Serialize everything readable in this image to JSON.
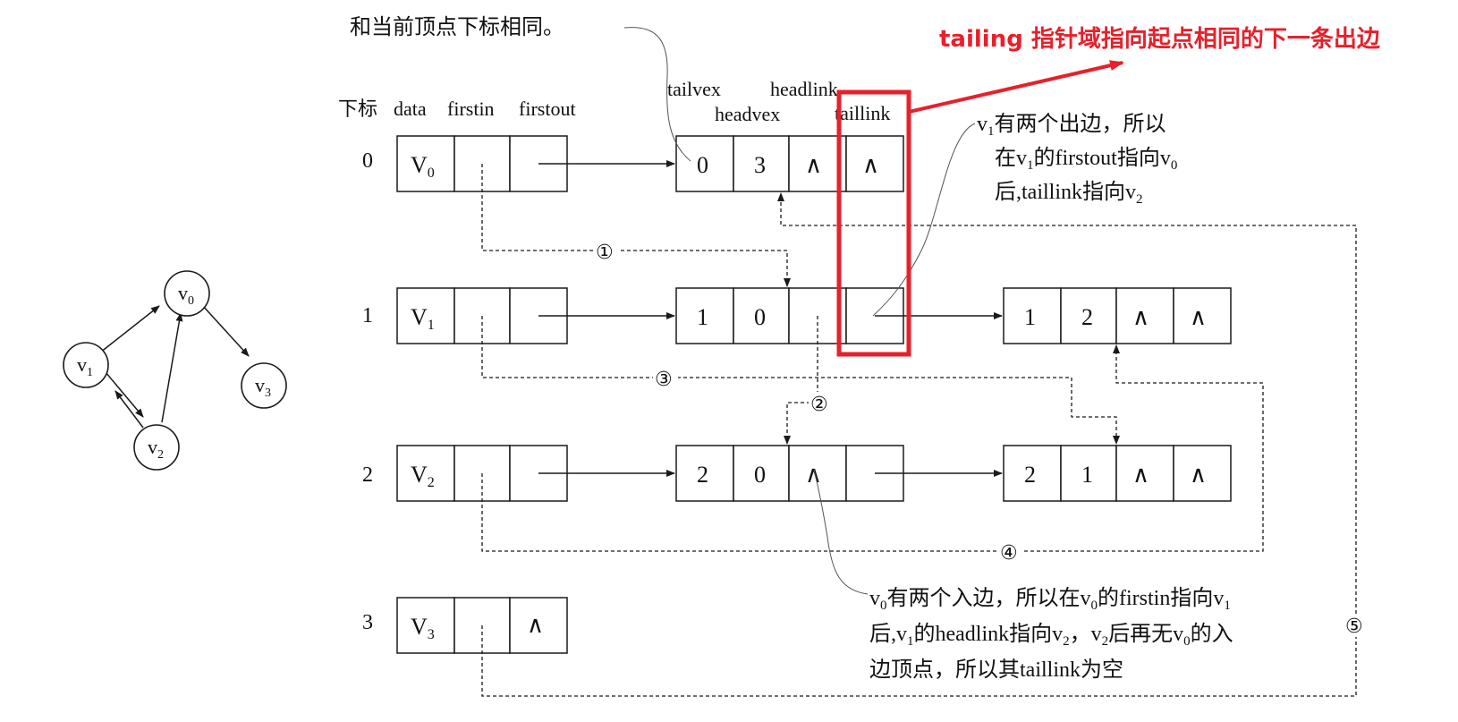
{
  "headers": {
    "index": "下标",
    "data": "data",
    "firstin": "firstin",
    "firstout": "firstout",
    "tailvex": "tailvex",
    "headvex": "headvex",
    "headlink": "headlink",
    "taillink": "taillink"
  },
  "vertex_table": [
    {
      "index": "0",
      "data": "V",
      "sub": "0",
      "firstout_null": ""
    },
    {
      "index": "1",
      "data": "V",
      "sub": "1",
      "firstout_null": ""
    },
    {
      "index": "2",
      "data": "V",
      "sub": "2",
      "firstout_null": ""
    },
    {
      "index": "3",
      "data": "V",
      "sub": "3",
      "firstout_null": "∧"
    }
  ],
  "edge_nodes": [
    {
      "tailvex": "0",
      "headvex": "3",
      "headlink": "∧",
      "taillink": "∧"
    },
    {
      "tailvex": "1",
      "headvex": "0",
      "headlink": "",
      "taillink": ""
    },
    {
      "tailvex": "1",
      "headvex": "2",
      "headlink": "∧",
      "taillink": "∧"
    },
    {
      "tailvex": "2",
      "headvex": "0",
      "headlink": "∧",
      "taillink": ""
    },
    {
      "tailvex": "2",
      "headvex": "1",
      "headlink": "∧",
      "taillink": "∧"
    }
  ],
  "graph_nodes": [
    {
      "label": "v",
      "sub": "0"
    },
    {
      "label": "v",
      "sub": "1"
    },
    {
      "label": "v",
      "sub": "2"
    },
    {
      "label": "v",
      "sub": "3"
    }
  ],
  "markers": [
    "①",
    "②",
    "③",
    "④",
    "⑤"
  ],
  "annotations": {
    "top_left": "和当前顶点下标相同。",
    "red_note": "tailing 指针域指向起点相同的下一条出边",
    "v1_note": {
      "line1_a": "v",
      "line1_sub": "1",
      "line1_b": "有两个出边，所以",
      "line2_a": "在v",
      "line2_sub": "1",
      "line2_b": "的firstout指向v",
      "line2_sub2": "0",
      "line3_a": "后,taillink指向v",
      "line3_sub": "2"
    },
    "v0_note": {
      "line1_a": "v",
      "line1_s1": "0",
      "line1_b": "有两个入边，所以在v",
      "line1_s2": "0",
      "line1_c": "的firstin指向v",
      "line1_s3": "1",
      "line2_a": "后,v",
      "line2_s1": "1",
      "line2_b": "的headlink指向v",
      "line2_s2": "2",
      "line2_c": "，v",
      "line2_s3": "2",
      "line2_d": "后再无v",
      "line2_s4": "0",
      "line2_e": "的入",
      "line3": "边顶点，所以其taillink为空"
    }
  },
  "colors": {
    "highlight": "#e8202b",
    "ink": "#1a1a1a"
  }
}
